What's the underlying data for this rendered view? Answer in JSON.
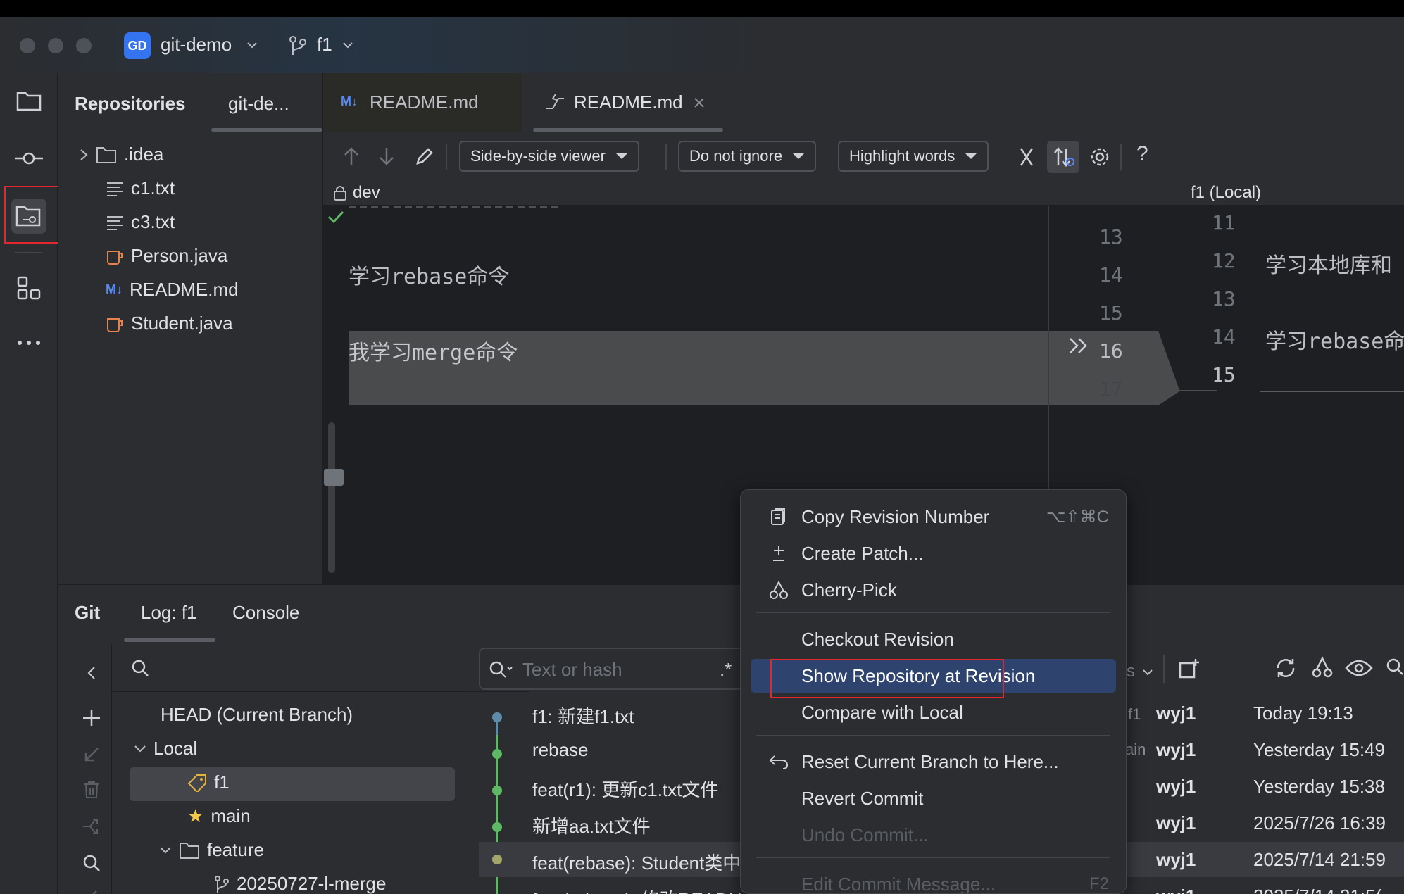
{
  "titlebar": {
    "project_badge": "GD",
    "project_name": "git-demo",
    "branch": "f1"
  },
  "project_panel": {
    "tabs": [
      "Repositories",
      "git-de..."
    ],
    "tree": [
      {
        "name": ".idea",
        "type": "folder"
      },
      {
        "name": "c1.txt",
        "type": "text"
      },
      {
        "name": "c3.txt",
        "type": "text"
      },
      {
        "name": "Person.java",
        "type": "java"
      },
      {
        "name": "README.md",
        "type": "markdown"
      },
      {
        "name": "Student.java",
        "type": "java"
      }
    ]
  },
  "editor": {
    "tabs": [
      {
        "label": "README.md",
        "icon": "markdown-icon"
      },
      {
        "label": "README.md",
        "icon": "diff-icon"
      }
    ],
    "toolbar": {
      "viewer": "Side-by-side viewer",
      "ignore": "Do not ignore",
      "highlight": "Highlight words"
    },
    "left_title": "dev",
    "right_title": "f1 (Local)",
    "left_lines": [
      {
        "text": "学习rebase命令"
      },
      {
        "text": "我学习merge命令"
      }
    ],
    "left_numbers": [
      "13",
      "14",
      "15",
      "16",
      "17"
    ],
    "right_numbers": [
      "11",
      "12",
      "13",
      "14",
      "15"
    ],
    "right_lines": [
      "学习本地库和",
      "学习rebase命"
    ]
  },
  "bottom": {
    "tabs": [
      "Git",
      "Log: f1",
      "Console"
    ],
    "branches": {
      "head": "HEAD (Current Branch)",
      "local": "Local",
      "f1": "f1",
      "main": "main",
      "feature": "feature",
      "merge_branch": "20250727-l-merge"
    },
    "search_placeholder": "Text or hash",
    "regex": ".*",
    "commits": [
      {
        "msg": "f1: 新建f1.txt",
        "ref": "f1",
        "author": "wyj1",
        "date": "Today 19:13"
      },
      {
        "msg": "rebase",
        "ref": "ain",
        "author": "wyj1",
        "date": "Yesterday 15:49"
      },
      {
        "msg": "feat(r1): 更新c1.txt文件",
        "ref": "",
        "author": "wyj1",
        "date": "Yesterday 15:38"
      },
      {
        "msg": "新增aa.txt文件",
        "ref": "",
        "author": "wyj1",
        "date": "2025/7/26 16:39"
      },
      {
        "msg": "feat(rebase): Student类中",
        "ref": "",
        "author": "wyj1",
        "date": "2025/7/14 21:59"
      },
      {
        "msg": "feat(rebase): 修改READN",
        "ref": "",
        "author": "wyj1",
        "date": "2025/7/14 21:5("
      }
    ]
  },
  "context_menu": {
    "items": [
      {
        "label": "Copy Revision Number",
        "shortcut": "⌥⇧⌘C"
      },
      {
        "label": "Create Patch..."
      },
      {
        "label": "Cherry-Pick"
      },
      {
        "label": "Checkout Revision"
      },
      {
        "label": "Show Repository at Revision"
      },
      {
        "label": "Compare with Local"
      },
      {
        "label": "Reset Current Branch to Here..."
      },
      {
        "label": "Revert Commit"
      },
      {
        "label": "Undo Commit..."
      },
      {
        "label": "Edit Commit Message...",
        "shortcut": "F2"
      }
    ]
  },
  "colors": {
    "accent": "#3574f0",
    "highlight_box": "#e5262c",
    "selected_menu": "#2e436e"
  }
}
